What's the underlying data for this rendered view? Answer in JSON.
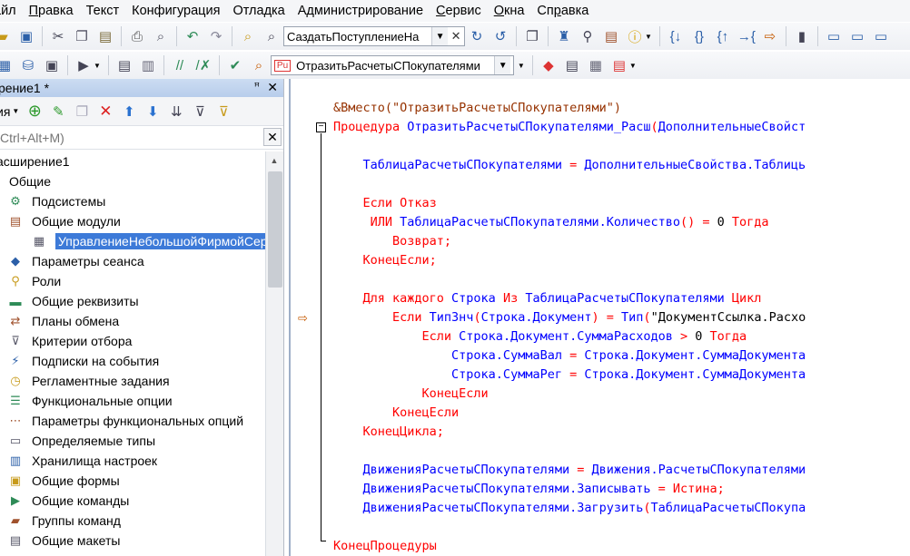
{
  "menu": {
    "items": [
      {
        "pre": "",
        "u": "",
        "post": "айл"
      },
      {
        "pre": "",
        "u": "П",
        "post": "равка"
      },
      {
        "pre": "Текст",
        "u": "",
        "post": ""
      },
      {
        "pre": "Конфигурация",
        "u": "",
        "post": ""
      },
      {
        "pre": "Отладка",
        "u": "",
        "post": ""
      },
      {
        "pre": "Администрирование",
        "u": "",
        "post": ""
      },
      {
        "pre": "",
        "u": "С",
        "post": "ервис"
      },
      {
        "pre": "",
        "u": "О",
        "post": "кна"
      },
      {
        "pre": "Сп",
        "u": "р",
        "post": "авка"
      }
    ]
  },
  "toolbar1": {
    "search_combo_value": "СаздатьПоступлениеНа",
    "icons": [
      "open-icon",
      "save-icon",
      "cut-icon",
      "copy-icon",
      "paste-icon",
      "print-icon",
      "preview-icon",
      "undo-icon",
      "redo-icon",
      "find-folder-icon",
      "find-icon"
    ],
    "icons_after": [
      "find-next-icon",
      "find-prev-icon",
      "windows-icon",
      "wizard-icon",
      "help-search-icon",
      "syntax-helper-icon",
      "info-icon",
      "step-into-icon",
      "step-over-icon",
      "step-out-icon",
      "run-to-cursor-icon",
      "current-line-icon",
      "breakpoint-icon",
      "new-window-icon",
      "cascade-icon",
      "tile-icon"
    ]
  },
  "toolbar2": {
    "procedure_combo_value": "ОтразитьРасчетыСПокупателями",
    "procedure_badge": "Pu"
  },
  "left_panel": {
    "title": "рение1 *",
    "actions_label": "ия",
    "search_placeholder": "Ctrl+Alt+M)",
    "tree": [
      {
        "label": "асширение1",
        "icon": "extension-icon",
        "glyph": "",
        "indent": 0,
        "state": ""
      },
      {
        "label": "Общие",
        "icon": "folder-expander-icon",
        "glyph": "",
        "indent": 10,
        "state": ""
      },
      {
        "label": "Подсистемы",
        "icon": "subsystems-icon",
        "glyph": "⚙",
        "indent": 8,
        "state": ""
      },
      {
        "label": "Общие модули",
        "icon": "common-modules-icon",
        "glyph": "▤",
        "indent": 8,
        "state": ""
      },
      {
        "label": "УправлениеНебольшойФирмойСер",
        "icon": "module-icon",
        "glyph": "▦",
        "indent": 34,
        "state": "selected"
      },
      {
        "label": "Параметры сеанса",
        "icon": "session-params-icon",
        "glyph": "◆",
        "indent": 8,
        "state": ""
      },
      {
        "label": "Роли",
        "icon": "roles-icon",
        "glyph": "⚲",
        "indent": 8,
        "state": ""
      },
      {
        "label": "Общие реквизиты",
        "icon": "common-attributes-icon",
        "glyph": "▬",
        "indent": 8,
        "state": ""
      },
      {
        "label": "Планы обмена",
        "icon": "exchange-plans-icon",
        "glyph": "⇄",
        "indent": 8,
        "state": ""
      },
      {
        "label": "Критерии отбора",
        "icon": "filter-criteria-icon",
        "glyph": "⊽",
        "indent": 8,
        "state": ""
      },
      {
        "label": "Подписки на события",
        "icon": "event-subscriptions-icon",
        "glyph": "⚡",
        "indent": 8,
        "state": ""
      },
      {
        "label": "Регламентные задания",
        "icon": "scheduled-jobs-icon",
        "glyph": "◷",
        "indent": 8,
        "state": ""
      },
      {
        "label": "Функциональные опции",
        "icon": "functional-options-icon",
        "glyph": "☰",
        "indent": 8,
        "state": ""
      },
      {
        "label": "Параметры функциональных опций",
        "icon": "fo-params-icon",
        "glyph": "⋯",
        "indent": 8,
        "state": ""
      },
      {
        "label": "Определяемые типы",
        "icon": "defined-types-icon",
        "glyph": "▭",
        "indent": 8,
        "state": ""
      },
      {
        "label": "Хранилища настроек",
        "icon": "settings-storage-icon",
        "glyph": "▥",
        "indent": 8,
        "state": ""
      },
      {
        "label": "Общие формы",
        "icon": "common-forms-icon",
        "glyph": "▣",
        "indent": 8,
        "state": ""
      },
      {
        "label": "Общие команды",
        "icon": "common-commands-icon",
        "glyph": "▶",
        "indent": 8,
        "state": ""
      },
      {
        "label": "Группы команд",
        "icon": "command-groups-icon",
        "glyph": "▰",
        "indent": 8,
        "state": ""
      },
      {
        "label": "Общие макеты",
        "icon": "common-templates-icon",
        "glyph": "▤",
        "indent": 8,
        "state": ""
      }
    ]
  },
  "editor": {
    "lines": [
      [
        {
          "c": "dir",
          "t": "&Вместо(\"ОтразитьРасчетыСПокупателями\")"
        }
      ],
      [
        {
          "c": "kw",
          "t": "Процедура "
        },
        {
          "c": "id",
          "t": "ОтразитьРасчетыСПокупателями_Расш"
        },
        {
          "c": "op",
          "t": "("
        },
        {
          "c": "id",
          "t": "ДополнительныеСвойст"
        }
      ],
      [
        {
          "c": "",
          "t": ""
        }
      ],
      [
        {
          "c": "id",
          "t": "    ТаблицаРасчетыСПокупателями "
        },
        {
          "c": "op",
          "t": "= "
        },
        {
          "c": "id",
          "t": "ДополнительныеСвойства.Таблиць"
        }
      ],
      [
        {
          "c": "",
          "t": ""
        }
      ],
      [
        {
          "c": "kw",
          "t": "    Если Отказ"
        }
      ],
      [
        {
          "c": "kw",
          "t": "     ИЛИ "
        },
        {
          "c": "id",
          "t": "ТаблицаРасчетыСПокупателями.Количество"
        },
        {
          "c": "op",
          "t": "() = "
        },
        {
          "c": "num",
          "t": "0 "
        },
        {
          "c": "kw",
          "t": "Тогда"
        }
      ],
      [
        {
          "c": "kw",
          "t": "        Возврат;"
        }
      ],
      [
        {
          "c": "kw",
          "t": "    КонецЕсли;"
        }
      ],
      [
        {
          "c": "",
          "t": ""
        }
      ],
      [
        {
          "c": "kw",
          "t": "    Для каждого "
        },
        {
          "c": "id",
          "t": "Строка "
        },
        {
          "c": "kw",
          "t": "Из "
        },
        {
          "c": "id",
          "t": "ТаблицаРасчетыСПокупателями "
        },
        {
          "c": "kw",
          "t": "Цикл"
        }
      ],
      [
        {
          "c": "kw",
          "t": "        Если "
        },
        {
          "c": "id",
          "t": "ТипЗнч"
        },
        {
          "c": "op",
          "t": "("
        },
        {
          "c": "id",
          "t": "Строка.Документ"
        },
        {
          "c": "op",
          "t": ") = "
        },
        {
          "c": "id",
          "t": "Тип"
        },
        {
          "c": "op",
          "t": "("
        },
        {
          "c": "str",
          "t": "\"ДокументСсылка.Расхо"
        }
      ],
      [
        {
          "c": "kw",
          "t": "            Если "
        },
        {
          "c": "id",
          "t": "Строка.Документ.СуммаРасходов "
        },
        {
          "c": "op",
          "t": "> "
        },
        {
          "c": "num",
          "t": "0 "
        },
        {
          "c": "kw",
          "t": "Тогда"
        }
      ],
      [
        {
          "c": "id",
          "t": "                Строка.СуммаВал "
        },
        {
          "c": "op",
          "t": "= "
        },
        {
          "c": "id",
          "t": "Строка.Документ.СуммаДокумента"
        }
      ],
      [
        {
          "c": "id",
          "t": "                Строка.СуммаРег "
        },
        {
          "c": "op",
          "t": "= "
        },
        {
          "c": "id",
          "t": "Строка.Документ.СуммаДокумента"
        }
      ],
      [
        {
          "c": "kw",
          "t": "            КонецЕсли"
        }
      ],
      [
        {
          "c": "kw",
          "t": "        КонецЕсли"
        }
      ],
      [
        {
          "c": "kw",
          "t": "    КонецЦикла;"
        }
      ],
      [
        {
          "c": "",
          "t": ""
        }
      ],
      [
        {
          "c": "id",
          "t": "    ДвиженияРасчетыСПокупателями "
        },
        {
          "c": "op",
          "t": "= "
        },
        {
          "c": "id",
          "t": "Движения.РасчетыСПокупателями"
        }
      ],
      [
        {
          "c": "id",
          "t": "    ДвиженияРасчетыСПокупателями.Записывать "
        },
        {
          "c": "op",
          "t": "= "
        },
        {
          "c": "kw",
          "t": "Истина"
        },
        {
          "c": "op",
          "t": ";"
        }
      ],
      [
        {
          "c": "id",
          "t": "    ДвиженияРасчетыСПокупателями.Загрузить"
        },
        {
          "c": "op",
          "t": "("
        },
        {
          "c": "id",
          "t": "ТаблицаРасчетыСПокупа"
        }
      ],
      [
        {
          "c": "",
          "t": ""
        }
      ],
      [
        {
          "c": "kw",
          "t": "КонецПроцедуры"
        }
      ]
    ]
  },
  "colors": {
    "keyword": "#ff0000",
    "identifier": "#0000ff",
    "directive": "#963200",
    "selection": "#3d7ad8",
    "panel_title": "#c5d7f0"
  }
}
